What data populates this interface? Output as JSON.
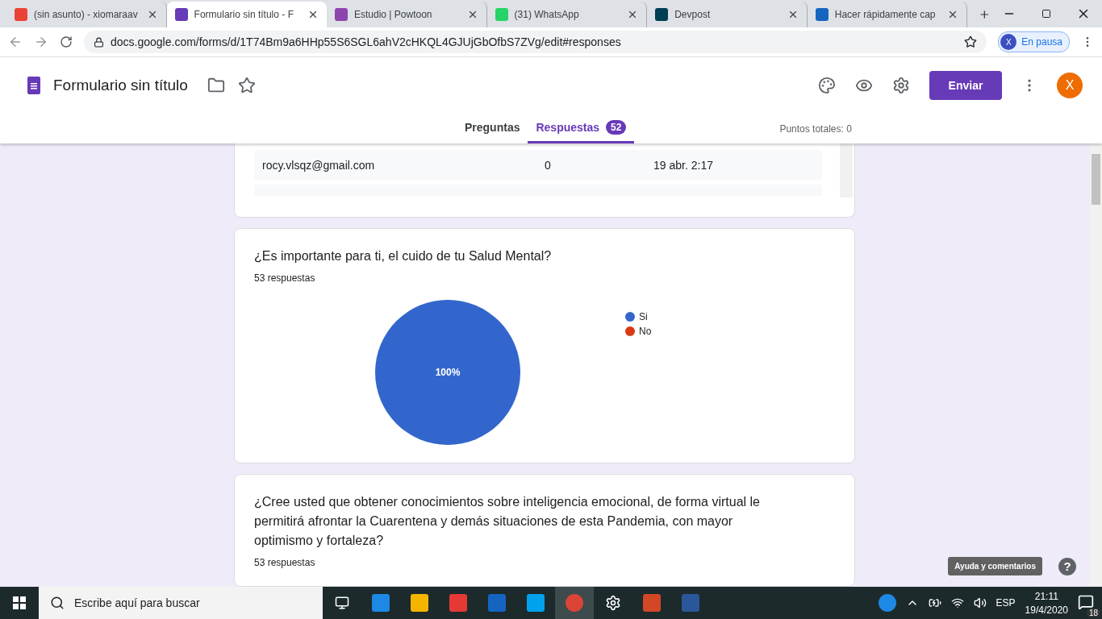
{
  "browser_tabs": [
    {
      "title": "(sin asunto) - xiomaraav",
      "selected": false,
      "kind": "gmail"
    },
    {
      "title": "Formulario sin título - F",
      "selected": true,
      "kind": "forms"
    },
    {
      "title": "Estudio | Powtoon",
      "selected": false,
      "kind": "powtoon"
    },
    {
      "title": "(31) WhatsApp",
      "selected": false,
      "kind": "whatsapp"
    },
    {
      "title": "Devpost",
      "selected": false,
      "kind": "devpost"
    },
    {
      "title": "Hacer rápidamente cap",
      "selected": false,
      "kind": "other"
    }
  ],
  "address_bar": {
    "url": "docs.google.com/forms/d/1T74Bm9a6HHp55S6SGL6ahV2cHKQL4GJUjGbOfbS7ZVg/edit#responses",
    "profile_initial": "X",
    "profile_status": "En pausa"
  },
  "form_header": {
    "title": "Formulario sin título",
    "send_button": "Enviar",
    "avatar_initial": "X"
  },
  "form_tabs": [
    {
      "label": "Preguntas",
      "selected": false
    },
    {
      "label": "Respuestas",
      "selected": true,
      "badge": "52"
    }
  ],
  "total_points": "Puntos totales: 0",
  "response_table": {
    "rows": [
      {
        "email": "rocy.vlsqz@gmail.com",
        "score": "0",
        "date": "19 abr. 2:17"
      }
    ]
  },
  "questions": [
    {
      "title": "¿Es importante para ti, el cuido de tu Salud Mental?",
      "count": "53 respuestas",
      "chart_data": {
        "type": "pie",
        "categories": [
          "Si",
          "No"
        ],
        "values": [
          100,
          0
        ],
        "value_labels": [
          "100%",
          null
        ]
      }
    },
    {
      "title": "¿Cree usted que obtener conocimientos sobre inteligencia emocional, de forma virtual le permitirá afrontar la Cuarentena y demás situaciones de esta Pandemia, con mayor optimismo y fortaleza?",
      "count": "53 respuestas"
    }
  ],
  "help": {
    "tooltip": "Ayuda y comentarios",
    "icon": "?"
  },
  "taskbar": {
    "search_placeholder": "Escribe aquí para buscar",
    "language": "ESP",
    "time": "21:11",
    "date": "19/4/2020",
    "notifications": "18"
  }
}
